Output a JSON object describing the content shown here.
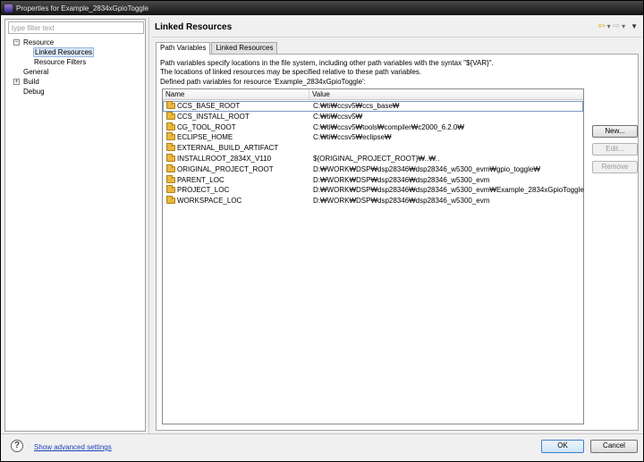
{
  "window": {
    "title": "Properties for Example_2834xGpioToggle",
    "app_icon": "eclipse-icon"
  },
  "filter": {
    "placeholder": "type filter text",
    "value": ""
  },
  "tree": [
    {
      "label": "Resource",
      "toggle": "−",
      "depth": 0
    },
    {
      "label": "Linked Resources",
      "toggle": "",
      "depth": 1,
      "selected": true
    },
    {
      "label": "Resource Filters",
      "toggle": "",
      "depth": 1
    },
    {
      "label": "General",
      "toggle": "",
      "depth": 0
    },
    {
      "label": "Build",
      "toggle": "+",
      "depth": 0
    },
    {
      "label": "Debug",
      "toggle": "",
      "depth": 0
    }
  ],
  "page": {
    "title": "Linked Resources"
  },
  "nav": {
    "back_icon": "⇦",
    "forward_icon": "⇨",
    "back_caret": "▾",
    "forward_caret": "▾",
    "menu_icon": "▼"
  },
  "tabs": [
    {
      "label": "Path Variables",
      "active": true
    },
    {
      "label": "Linked Resources",
      "active": false
    }
  ],
  "description": {
    "line1": "Path variables specify locations in the file system, including other path variables with the syntax \"${VAR}\".",
    "line2": "The locations of linked resources may be specified relative to these path variables."
  },
  "defined_label": "Defined path variables for resource 'Example_2834xGpioToggle':",
  "table": {
    "columns": [
      "Name",
      "Value"
    ],
    "rows": [
      {
        "name": "CCS_BASE_ROOT",
        "value": "C:₩ti₩ccsv5₩ccs_base₩"
      },
      {
        "name": "CCS_INSTALL_ROOT",
        "value": "C:₩ti₩ccsv5₩"
      },
      {
        "name": "CG_TOOL_ROOT",
        "value": "C:₩ti₩ccsv5₩tools₩compiler₩c2000_6.2.0₩"
      },
      {
        "name": "ECLIPSE_HOME",
        "value": "C:₩ti₩ccsv5₩eclipse₩"
      },
      {
        "name": "EXTERNAL_BUILD_ARTIFACT",
        "value": ""
      },
      {
        "name": "INSTALLROOT_2834X_V110",
        "value": "${ORIGINAL_PROJECT_ROOT}₩..₩.."
      },
      {
        "name": "ORIGINAL_PROJECT_ROOT",
        "value": "D:₩WORK₩DSP₩dsp28346₩dsp28346_w5300_evm₩gpio_toggle₩"
      },
      {
        "name": "PARENT_LOC",
        "value": "D:₩WORK₩DSP₩dsp28346₩dsp28346_w5300_evm"
      },
      {
        "name": "PROJECT_LOC",
        "value": "D:₩WORK₩DSP₩dsp28346₩dsp28346_w5300_evm₩Example_2834xGpioToggle"
      },
      {
        "name": "WORKSPACE_LOC",
        "value": "D:₩WORK₩DSP₩dsp28346₩dsp28346_w5300_evm"
      }
    ]
  },
  "buttons": {
    "new": "New...",
    "edit": "Edit...",
    "remove": "Remove",
    "ok": "OK",
    "cancel": "Cancel"
  },
  "footer": {
    "help_icon": "?",
    "show_advanced": "Show advanced settings"
  },
  "colors": {
    "folder": "#e8b840",
    "link": "#1a44b8",
    "selection": "#d8e6f6"
  }
}
